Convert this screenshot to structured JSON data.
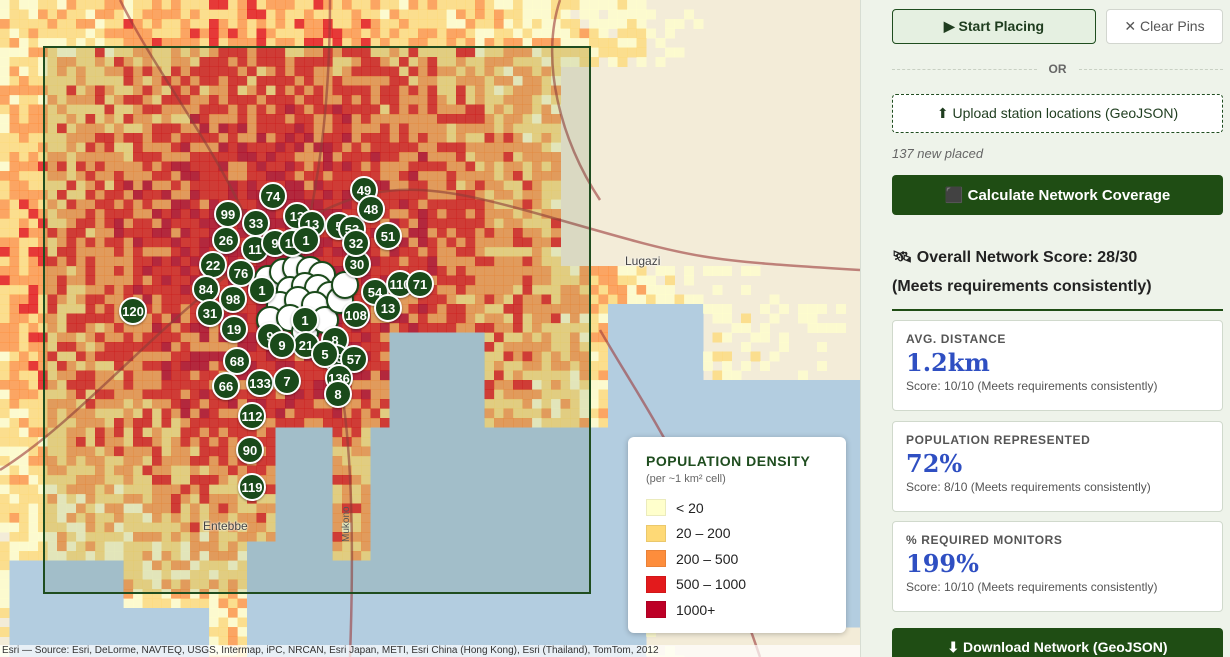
{
  "map": {
    "place_labels": [
      "Lugazi",
      "Entebbe"
    ],
    "road_labels": [
      "Mukono"
    ],
    "attribution": "Esri — Source: Esri, DeLorme, NAVTEQ, USGS, Intermap, iPC, NRCAN, Esri Japan, METI, Esri China (Hong Kong), Esri (Thailand), TomTom, 2012",
    "pins": [
      "74",
      "49",
      "99",
      "33",
      "13",
      "13",
      "5",
      "53",
      "48",
      "26",
      "11",
      "9",
      "12",
      "1",
      "51",
      "22",
      "76",
      "30",
      "32",
      "84",
      "98",
      "1",
      "54",
      "110",
      "71",
      "120",
      "31",
      "1",
      "108",
      "13",
      "19",
      "9",
      "8",
      "21",
      "13",
      "5",
      "57",
      "68",
      "9",
      "66",
      "133",
      "7",
      "136",
      "8",
      "112",
      "90",
      "119"
    ],
    "legend": {
      "title": "POPULATION DENSITY",
      "subtitle": "(per ~1 km² cell)",
      "items": [
        {
          "label": "< 20",
          "color": "#ffffcc"
        },
        {
          "label": "20 – 200",
          "color": "#fed976"
        },
        {
          "label": "200 – 500",
          "color": "#fd8d3c"
        },
        {
          "label": "500 – 1000",
          "color": "#e31a1c"
        },
        {
          "label": "1000+",
          "color": "#bd0026"
        }
      ]
    }
  },
  "panel": {
    "start_label": "▶ Start Placing",
    "clear_label": "✕ Clear Pins",
    "or_label": "OR",
    "upload_label": "⬆ Upload station locations (GeoJSON)",
    "placed_status": "137 new placed",
    "calc_label": "⬛ Calculate Network Coverage",
    "score_title": "🛰 Overall Network Score: 28/30",
    "score_subtitle": "(Meets requirements consistently)",
    "cards": [
      {
        "label": "AVG. DISTANCE",
        "value": "1.2km",
        "note": "Score: 10/10 (Meets requirements consistently)"
      },
      {
        "label": "POPULATION REPRESENTED",
        "value": "72%",
        "note": "Score: 8/10 (Meets requirements consistently)"
      },
      {
        "label": "% REQUIRED MONITORS",
        "value": "199%",
        "note": "Score: 10/10 (Meets requirements consistently)"
      }
    ],
    "download_label": "⬇ Download Network (GeoJSON)"
  },
  "colors": {
    "accent": "#1f4d14",
    "value_blue": "#2f4fc2",
    "water": "#b3cde0"
  }
}
